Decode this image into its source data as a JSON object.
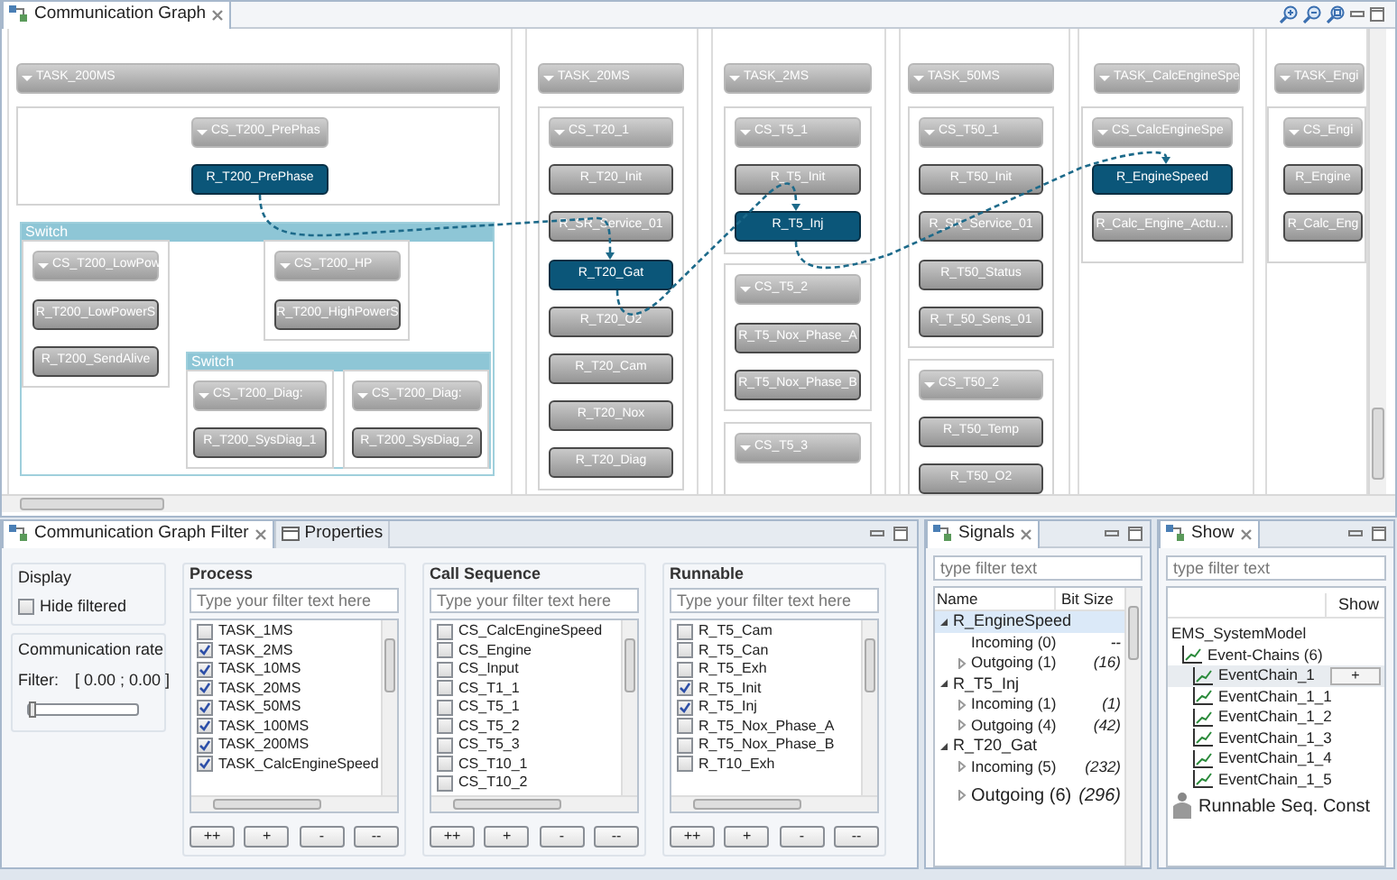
{
  "graph_view": {
    "tab": {
      "label": "Communication Graph",
      "selected": true
    },
    "lanes": [
      {
        "title": "TASK_200MS",
        "groups": [
          {
            "title": "CS_T200_PrePhas",
            "runnables": [
              {
                "label": "R_T200_PrePhase",
                "selected": true
              }
            ]
          }
        ],
        "switches": [
          {
            "label": "Switch",
            "groups": [
              {
                "title": "CS_T200_LowPow",
                "runnables": [
                  {
                    "label": "R_T200_LowPowerS",
                    "selected": false
                  },
                  {
                    "label": "R_T200_SendAlive",
                    "selected": false
                  }
                ]
              },
              {
                "title": "CS_T200_HP",
                "runnables": [
                  {
                    "label": "R_T200_HighPowerS",
                    "selected": false
                  }
                ]
              }
            ],
            "switches": [
              {
                "label": "Switch",
                "groups": [
                  {
                    "title": "CS_T200_Diag:",
                    "runnables": [
                      {
                        "label": "R_T200_SysDiag_1",
                        "selected": false
                      }
                    ]
                  },
                  {
                    "title": "CS_T200_Diag:",
                    "runnables": [
                      {
                        "label": "R_T200_SysDiag_2",
                        "selected": false
                      }
                    ]
                  }
                ]
              }
            ]
          }
        ]
      },
      {
        "title": "TASK_20MS",
        "groups": [
          {
            "title": "CS_T20_1",
            "runnables": [
              {
                "label": "R_T20_Init",
                "selected": false
              },
              {
                "label": "R_SR_Service_01",
                "selected": false
              },
              {
                "label": "R_T20_Gat",
                "selected": true
              },
              {
                "label": "R_T20_O2",
                "selected": false
              },
              {
                "label": "R_T20_Cam",
                "selected": false
              },
              {
                "label": "R_T20_Nox",
                "selected": false
              },
              {
                "label": "R_T20_Diag",
                "selected": false
              }
            ]
          }
        ]
      },
      {
        "title": "TASK_2MS",
        "groups": [
          {
            "title": "CS_T5_1",
            "runnables": [
              {
                "label": "R_T5_Init",
                "selected": false
              },
              {
                "label": "R_T5_Inj",
                "selected": true
              }
            ]
          },
          {
            "title": "CS_T5_2",
            "runnables": [
              {
                "label": "R_T5_Nox_Phase_A",
                "selected": false
              },
              {
                "label": "R_T5_Nox_Phase_B",
                "selected": false
              }
            ]
          },
          {
            "title": "CS_T5_3"
          }
        ]
      },
      {
        "title": "TASK_50MS",
        "groups": [
          {
            "title": "CS_T50_1",
            "runnables": [
              {
                "label": "R_T50_Init",
                "selected": false
              },
              {
                "label": "R_SR_Service_01",
                "selected": false
              },
              {
                "label": "R_T50_Status",
                "selected": false
              },
              {
                "label": "R_T_50_Sens_01",
                "selected": false
              }
            ]
          },
          {
            "title": "CS_T50_2",
            "runnables": [
              {
                "label": "R_T50_Temp",
                "selected": false
              },
              {
                "label": "R_T50_O2",
                "selected": false
              }
            ]
          }
        ]
      },
      {
        "title": "TASK_CalcEngineSpe",
        "groups": [
          {
            "title": "CS_CalcEngineSpe",
            "runnables": [
              {
                "label": "R_EngineSpeed",
                "selected": true
              },
              {
                "label": "R_Calc_Engine_Actu…",
                "selected": false
              }
            ]
          }
        ]
      },
      {
        "title": "TASK_Engi",
        "groups": [
          {
            "title": "CS_Engi",
            "runnables": [
              {
                "label": "R_Engine",
                "selected": false
              },
              {
                "label": "R_Calc_Eng",
                "selected": false
              }
            ]
          }
        ]
      }
    ]
  },
  "filter_panel": {
    "tabs": [
      {
        "label": "Communication Graph Filter",
        "selected": true
      },
      {
        "label": "Properties",
        "selected": false
      }
    ],
    "display": {
      "title": "Display",
      "hide_filtered": {
        "label": "Hide filtered",
        "checked": false
      }
    },
    "rate": {
      "title": "Communication rate",
      "filter_label": "Filter:",
      "range": "[ 0.00 ; 0.00 ]",
      "level": 0
    },
    "lists": [
      {
        "title": "Process",
        "placeholder": "Type your filter text here",
        "buttons": [
          "++",
          "+",
          "-",
          "--"
        ],
        "items": [
          {
            "label": "TASK_1MS",
            "checked": false
          },
          {
            "label": "TASK_2MS",
            "checked": true
          },
          {
            "label": "TASK_10MS",
            "checked": true
          },
          {
            "label": "TASK_20MS",
            "checked": true
          },
          {
            "label": "TASK_50MS",
            "checked": true
          },
          {
            "label": "TASK_100MS",
            "checked": true
          },
          {
            "label": "TASK_200MS",
            "checked": true
          },
          {
            "label": "TASK_CalcEngineSpeed",
            "checked": true
          }
        ]
      },
      {
        "title": "Call Sequence",
        "placeholder": "Type your filter text here",
        "buttons": [
          "++",
          "+",
          "-",
          "--"
        ],
        "items": [
          {
            "label": "CS_CalcEngineSpeed",
            "checked": false
          },
          {
            "label": "CS_Engine",
            "checked": false
          },
          {
            "label": "CS_Input",
            "checked": false
          },
          {
            "label": "CS_T1_1",
            "checked": false
          },
          {
            "label": "CS_T5_1",
            "checked": false
          },
          {
            "label": "CS_T5_2",
            "checked": false
          },
          {
            "label": "CS_T5_3",
            "checked": false
          },
          {
            "label": "CS_T10_1",
            "checked": false
          },
          {
            "label": "CS_T10_2",
            "checked": false
          }
        ]
      },
      {
        "title": "Runnable",
        "placeholder": "Type your filter text here",
        "buttons": [
          "++",
          "+",
          "-",
          "--"
        ],
        "items": [
          {
            "label": "R_T5_Cam",
            "checked": false
          },
          {
            "label": "R_T5_Can",
            "checked": false
          },
          {
            "label": "R_T5_Exh",
            "checked": false
          },
          {
            "label": "R_T5_Init",
            "checked": true
          },
          {
            "label": "R_T5_Inj",
            "checked": true
          },
          {
            "label": "R_T5_Nox_Phase_A",
            "checked": false
          },
          {
            "label": "R_T5_Nox_Phase_B",
            "checked": false
          },
          {
            "label": "R_T10_Exh",
            "checked": false
          }
        ]
      }
    ]
  },
  "signals": {
    "tab": {
      "label": "Signals",
      "selected": true
    },
    "placeholder": "type filter text",
    "columns": [
      "Name",
      "Bit Size"
    ],
    "rows": [
      {
        "name": "R_EngineSpeed",
        "expanded": true,
        "selected": true,
        "children": [
          {
            "name": "Incoming (0)",
            "bit_size": "--",
            "selected": false
          },
          {
            "name": "Outgoing (1)",
            "bit_size": "(16)",
            "expanded": false,
            "selected": false
          }
        ]
      },
      {
        "name": "R_T5_Inj",
        "expanded": true,
        "selected": false,
        "children": [
          {
            "name": "Incoming (1)",
            "bit_size": "(1)",
            "expanded": false,
            "selected": false
          },
          {
            "name": "Outgoing (4)",
            "bit_size": "(42)",
            "expanded": false,
            "selected": false
          }
        ]
      },
      {
        "name": "R_T20_Gat",
        "expanded": true,
        "selected": false,
        "children": [
          {
            "name": "Incoming (5)",
            "bit_size": "(232)",
            "expanded": false,
            "selected": false
          },
          {
            "name": "Outgoing (6)",
            "bit_size": "(296)",
            "expanded": false,
            "selected": false,
            "kind": "large"
          }
        ]
      }
    ]
  },
  "show": {
    "tab": {
      "label": "Show",
      "selected": true
    },
    "placeholder": "type filter text",
    "columns": [
      "Show"
    ],
    "tree": [
      {
        "label": "EMS_SystemModel",
        "kind": "plain",
        "selected": false,
        "children": [
          {
            "label": "Event-Chains (6)",
            "kind": "chain",
            "selected": false,
            "children": [
              {
                "label": "EventChain_1",
                "kind": "chain",
                "selected": true,
                "action": "+"
              },
              {
                "label": "EventChain_1_1",
                "kind": "chain",
                "selected": false
              },
              {
                "label": "EventChain_1_2",
                "kind": "chain",
                "selected": false
              },
              {
                "label": "EventChain_1_3",
                "kind": "chain",
                "selected": false
              },
              {
                "label": "EventChain_1_4",
                "kind": "chain",
                "selected": false
              },
              {
                "label": "EventChain_1_5",
                "kind": "chain",
                "selected": false
              }
            ]
          }
        ]
      },
      {
        "label": "Runnable Seq. Const",
        "kind": "large",
        "selected": false
      }
    ]
  }
}
